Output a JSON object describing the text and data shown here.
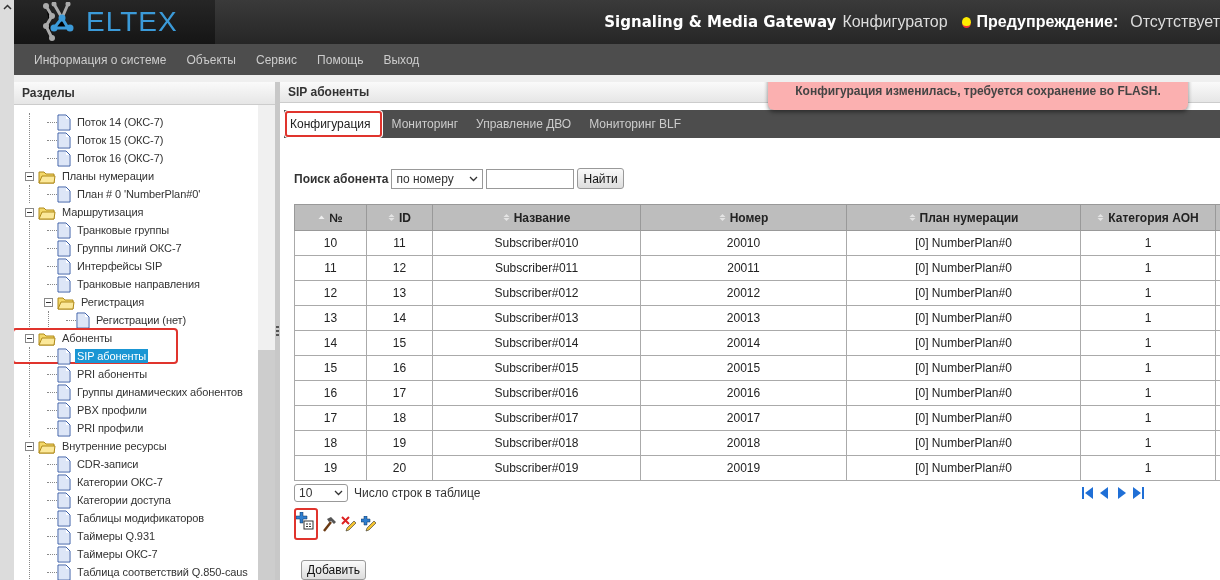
{
  "header": {
    "logo": "ELTEX",
    "product": "Signaling & Media Gateway",
    "product_sub": "Конфигуратор",
    "warning_label": "Предупреждение:",
    "warning_value": "Отсутствует"
  },
  "menu": [
    "Информация о системе",
    "Объекты",
    "Сервис",
    "Помощь",
    "Выход"
  ],
  "sidebar": {
    "title": "Разделы",
    "tree": [
      {
        "children": [
          {
            "label": "Поток 14 (ОКС-7)",
            "selected": false
          },
          {
            "label": "Поток 15 (ОКС-7)",
            "selected": false
          },
          {
            "label": "Поток 16 (ОКС-7)",
            "selected": false
          }
        ]
      },
      {
        "label": "Планы нумерации",
        "selected": false,
        "expanded": true,
        "children": [
          {
            "label": "План # 0 'NumberPlan#0'",
            "selected": false
          }
        ]
      },
      {
        "label": "Маршрутизация",
        "selected": false,
        "expanded": true,
        "children": [
          {
            "label": "Транковые группы",
            "selected": false
          },
          {
            "label": "Группы линий ОКС-7",
            "selected": false
          },
          {
            "label": "Интерфейсы SIP",
            "selected": false
          },
          {
            "label": "Транковые направления",
            "selected": false
          },
          {
            "label": "Регистрация",
            "selected": false,
            "expanded": true,
            "children": [
              {
                "label": "Регистрации (нет)",
                "selected": false
              }
            ]
          }
        ]
      },
      {
        "label": "Абоненты",
        "selected": false,
        "expanded": true,
        "highlighted": true,
        "children": [
          {
            "label": "SIP абоненты",
            "selected": true
          },
          {
            "label": "PRI абоненты",
            "selected": false
          },
          {
            "label": "Группы динамических абонентов",
            "selected": false
          },
          {
            "label": "PBX профили",
            "selected": false
          },
          {
            "label": "PRI профили",
            "selected": false
          }
        ]
      },
      {
        "label": "Внутренние ресурсы",
        "selected": false,
        "expanded": true,
        "children": [
          {
            "label": "CDR-записи",
            "selected": false
          },
          {
            "label": "Категории ОКС-7",
            "selected": false
          },
          {
            "label": "Категории доступа",
            "selected": false
          },
          {
            "label": "Таблицы модификаторов",
            "selected": false
          },
          {
            "label": "Таймеры Q.931",
            "selected": false
          },
          {
            "label": "Таймеры ОКС-7",
            "selected": false
          },
          {
            "label": "Таблица соответствий Q.850-caus",
            "selected": false
          }
        ]
      }
    ]
  },
  "main": {
    "title": "SIP абоненты",
    "notice": "Конфигурация изменилась, требуется сохранение во FLASH.",
    "tabs": [
      {
        "label": "Конфигурация",
        "selected": true,
        "highlighted": true
      },
      {
        "label": "Мониторинг",
        "selected": false,
        "highlighted": false
      },
      {
        "label": "Управление ДВО",
        "selected": false,
        "highlighted": false
      },
      {
        "label": "Мониторинг BLF",
        "selected": false,
        "highlighted": false
      }
    ],
    "search": {
      "label": "Поиск абонента",
      "mode": "по номеру",
      "button": "Найти"
    },
    "table": {
      "columns": [
        {
          "label": "№",
          "sorted": true
        },
        {
          "label": "ID",
          "sorted": false
        },
        {
          "label": "Название",
          "sorted": false
        },
        {
          "label": "Номер",
          "sorted": false
        },
        {
          "label": "План нумерации",
          "sorted": false
        },
        {
          "label": "Категория АОН",
          "sorted": false
        }
      ],
      "rows": [
        [
          "10",
          "11",
          "Subscriber#010",
          "20010",
          "[0] NumberPlan#0",
          "1"
        ],
        [
          "11",
          "12",
          "Subscriber#011",
          "20011",
          "[0] NumberPlan#0",
          "1"
        ],
        [
          "12",
          "13",
          "Subscriber#012",
          "20012",
          "[0] NumberPlan#0",
          "1"
        ],
        [
          "13",
          "14",
          "Subscriber#013",
          "20013",
          "[0] NumberPlan#0",
          "1"
        ],
        [
          "14",
          "15",
          "Subscriber#014",
          "20014",
          "[0] NumberPlan#0",
          "1"
        ],
        [
          "15",
          "16",
          "Subscriber#015",
          "20015",
          "[0] NumberPlan#0",
          "1"
        ],
        [
          "16",
          "17",
          "Subscriber#016",
          "20016",
          "[0] NumberPlan#0",
          "1"
        ],
        [
          "17",
          "18",
          "Subscriber#017",
          "20017",
          "[0] NumberPlan#0",
          "1"
        ],
        [
          "18",
          "19",
          "Subscriber#018",
          "20018",
          "[0] NumberPlan#0",
          "1"
        ],
        [
          "19",
          "20",
          "Subscriber#019",
          "20019",
          "[0] NumberPlan#0",
          "1"
        ]
      ]
    },
    "page_size": "10",
    "page_size_label": "Число строк в таблице",
    "tools": [
      {
        "kind": "add-row",
        "highlighted": true
      },
      {
        "kind": "hammer",
        "highlighted": false
      },
      {
        "kind": "delete-edit",
        "highlighted": false
      },
      {
        "kind": "add-edit",
        "highlighted": false
      }
    ],
    "add_button": "Добавить"
  }
}
